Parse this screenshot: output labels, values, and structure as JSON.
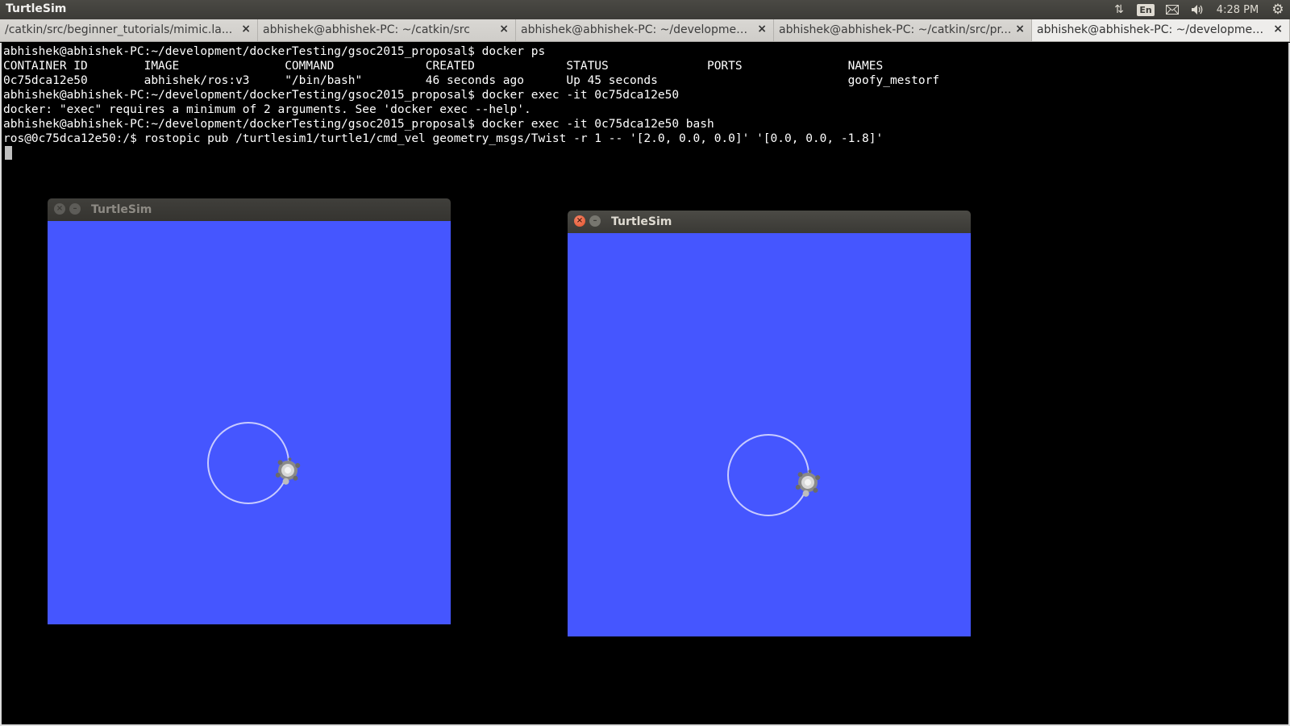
{
  "panel": {
    "app_title": "TurtleSim",
    "network_icon": "⇅",
    "keyboard_layout": "En",
    "mail_icon": "✉",
    "sound_icon": "🔊",
    "clock": "4:28 PM",
    "settings_icon": "⚙"
  },
  "tabs": [
    {
      "label": "/catkin/src/beginner_tutorials/mimic.la...",
      "close": "×"
    },
    {
      "label": "abhishek@abhishek-PC: ~/catkin/src",
      "close": "×"
    },
    {
      "label": "abhishek@abhishek-PC: ~/development...",
      "close": "×"
    },
    {
      "label": "abhishek@abhishek-PC: ~/catkin/src/pr...",
      "close": "×"
    },
    {
      "label": "abhishek@abhishek-PC: ~/development...",
      "close": "×",
      "active": true
    }
  ],
  "terminal": {
    "lines": [
      "abhishek@abhishek-PC:~/development/dockerTesting/gsoc2015_proposal$ docker ps",
      "CONTAINER ID        IMAGE               COMMAND             CREATED             STATUS              PORTS               NAMES",
      "0c75dca12e50        abhishek/ros:v3     \"/bin/bash\"         46 seconds ago      Up 45 seconds                           goofy_mestorf",
      "abhishek@abhishek-PC:~/development/dockerTesting/gsoc2015_proposal$ docker exec -it 0c75dca12e50",
      "docker: \"exec\" requires a minimum of 2 arguments. See 'docker exec --help'.",
      "abhishek@abhishek-PC:~/development/dockerTesting/gsoc2015_proposal$ docker exec -it 0c75dca12e50 bash",
      "ros@0c75dca12e50:/$ rostopic pub /turtlesim1/turtle1/cmd_vel geometry_msgs/Twist -r 1 -- '[2.0, 0.0, 0.0]' '[0.0, 0.0, -1.8]'"
    ]
  },
  "windows": {
    "left": {
      "title": "TurtleSim",
      "close": "×",
      "minimize": "–"
    },
    "right": {
      "title": "TurtleSim",
      "close": "×",
      "minimize": "–"
    }
  },
  "colors": {
    "canvas_bg": "#4556ff",
    "trail": "#c8cbff",
    "turtle": "#9a9a9a"
  }
}
